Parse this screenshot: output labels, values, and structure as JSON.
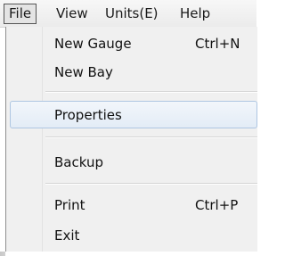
{
  "menubar": {
    "items": [
      {
        "label": "File"
      },
      {
        "label": "View"
      },
      {
        "label": "Units(E)"
      },
      {
        "label": "Help"
      }
    ]
  },
  "file_menu": {
    "items": [
      {
        "label": "New Gauge",
        "shortcut": "Ctrl+N"
      },
      {
        "label": "New Bay",
        "shortcut": ""
      },
      {
        "label": "Properties",
        "shortcut": "",
        "highlighted": true
      },
      {
        "label": "Backup",
        "shortcut": ""
      },
      {
        "label": "Print",
        "shortcut": "Ctrl+P"
      },
      {
        "label": "Exit",
        "shortcut": ""
      }
    ]
  },
  "colors": {
    "menu_background": "#f0f0f0",
    "highlight_border": "#aec6e2",
    "highlight_fill": "#e3ecf6",
    "active_menubar_border": "#555555"
  }
}
